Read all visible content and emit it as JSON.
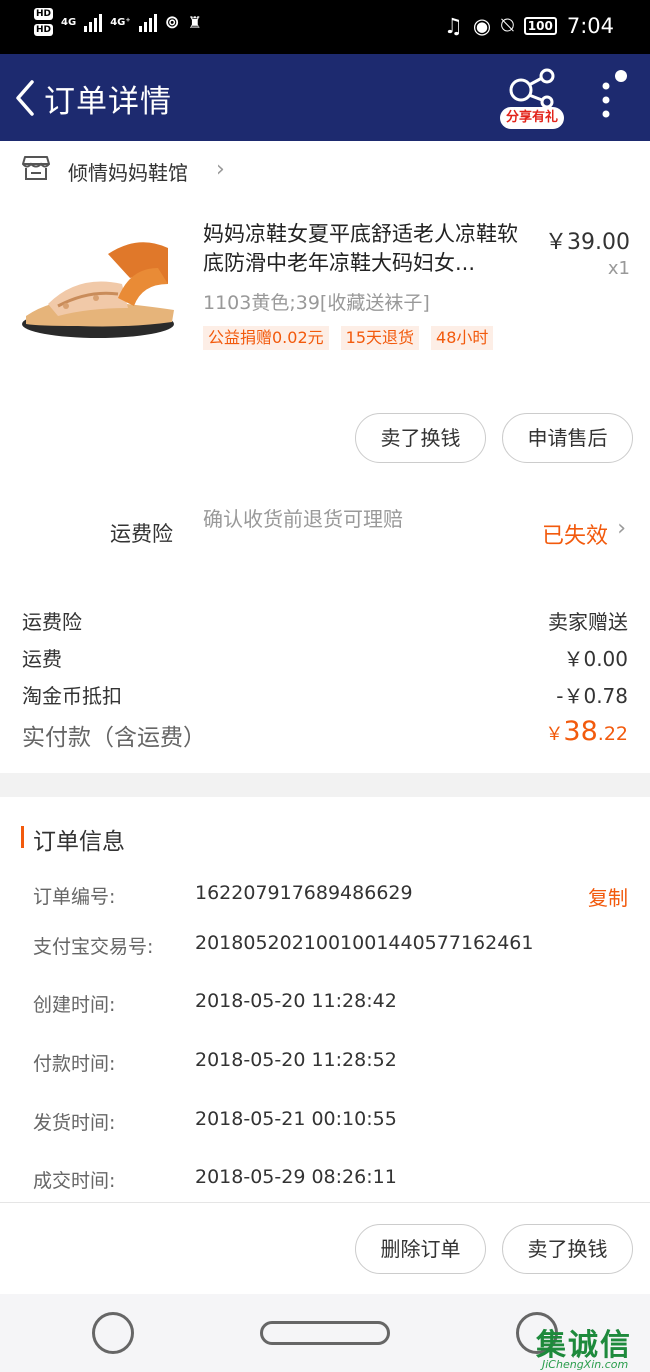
{
  "status_bar": {
    "hd1": "HD",
    "hd2": "HD",
    "net1": "4G",
    "net2": "4G⁺",
    "battery": "100",
    "time": "7:04"
  },
  "header": {
    "title": "订单详情",
    "share_badge": "分享有礼",
    "bg_color": "#1d2a6f"
  },
  "shop": {
    "name": "倾情妈妈鞋馆"
  },
  "product": {
    "title": "妈妈凉鞋女夏平底舒适老人凉鞋软底防滑中老年凉鞋大码妇女...",
    "price": "￥39.00",
    "qty": "x1",
    "sku": "1103黄色;39[收藏送袜子]",
    "tags": [
      "公益捐赠0.02元",
      "15天退货",
      "48小时"
    ]
  },
  "actions_top": {
    "sell_label": "卖了换钱",
    "aftersale_label": "申请售后"
  },
  "insurance": {
    "label": "运费险",
    "desc": "确认收货前退货可理赔",
    "status": "已失效"
  },
  "fees": [
    {
      "label": "运费险",
      "value": "卖家赠送"
    },
    {
      "label": "运费",
      "value": "￥0.00"
    },
    {
      "label": "淘金币抵扣",
      "value": "-￥0.78"
    }
  ],
  "total": {
    "label": "实付款（含运费）",
    "currency": "￥",
    "integer": "38",
    "decimal": ".22"
  },
  "order_info": {
    "title": "订单信息",
    "copy_label": "复制",
    "rows": [
      {
        "label": "订单编号:",
        "value": "162207917689486629"
      },
      {
        "label": "支付宝交易号:",
        "value": "2018052021001001440577162461"
      },
      {
        "label": "创建时间:",
        "value": "2018-05-20 11:28:42"
      },
      {
        "label": "付款时间:",
        "value": "2018-05-20 11:28:52"
      },
      {
        "label": "发货时间:",
        "value": "2018-05-21 00:10:55"
      },
      {
        "label": "成交时间:",
        "value": "2018-05-29 08:26:11"
      }
    ]
  },
  "actions_bottom": {
    "delete_label": "删除订单",
    "sell_label": "卖了换钱"
  },
  "watermark": {
    "logo": "集诚信",
    "url": "JiChengXin.com"
  },
  "colors": {
    "accent": "#f25a0d",
    "header": "#1d2a6f"
  }
}
